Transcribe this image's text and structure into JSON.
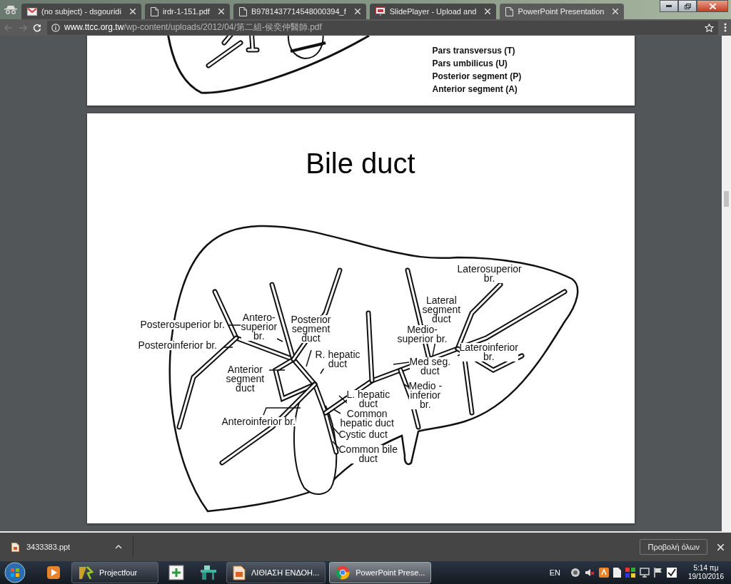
{
  "browser": {
    "tabs": [
      {
        "title": "(no subject) - dsgouridi",
        "selected": false
      },
      {
        "title": "irdr-1-151.pdf",
        "selected": false
      },
      {
        "title": "B9781437714548000394_f",
        "selected": false
      },
      {
        "title": "SlidePlayer - Upload and",
        "selected": false
      },
      {
        "title": "PowerPoint Presentation",
        "selected": true
      }
    ],
    "address": {
      "host": "www.ttcc.org.tw",
      "path": "/wp-content/uploads/2012/04/第二組-侯奕仲醫師.pdf"
    }
  },
  "document": {
    "page_1": {
      "legend": [
        "Pars transversus (T)",
        "Pars umbilicus (U)",
        "Posterior segment (P)",
        "Anterior segment (A)"
      ]
    },
    "page_2": {
      "title": "Bile duct",
      "labels": [
        "Laterosuperior\nbr.",
        "Lateral\nsegment\nduct",
        "Posterosuperior br.",
        "Antero-\nsuperior\nbr.",
        "Posterior\nsegment\nduct",
        "Medio-\nsuperior br.",
        "Posteroinferior br.",
        "R. hepatic\nduct",
        "Lateroinferior\nbr.",
        "Anterior\nsegment\nduct",
        "Med seg.\nduct",
        "L. hepatic\nduct",
        "Medio -\ninferior\nbr.",
        "Anteroinferior br.",
        "Common\nhepatic duct",
        "Cystic duct",
        "Common bile\nduct"
      ]
    }
  },
  "downloads": {
    "items": [
      {
        "name": "3433383.ppt"
      }
    ],
    "show_all": "Προβολή όλων"
  },
  "taskbar": {
    "items": [
      {
        "kind": "icon",
        "selected": false
      },
      {
        "kind": "button",
        "label": "Projectfour",
        "selected": false
      },
      {
        "kind": "icon",
        "selected": false
      },
      {
        "kind": "icon",
        "selected": false
      },
      {
        "kind": "button",
        "label": "ΛΙΘΙΑΣΗ ΕΝΔΟΗ...",
        "selected": false
      },
      {
        "kind": "button",
        "label": "PowerPoint Prese...",
        "selected": true
      }
    ],
    "language": "EN",
    "time": "5:14 πμ",
    "date": "19/10/2016"
  }
}
